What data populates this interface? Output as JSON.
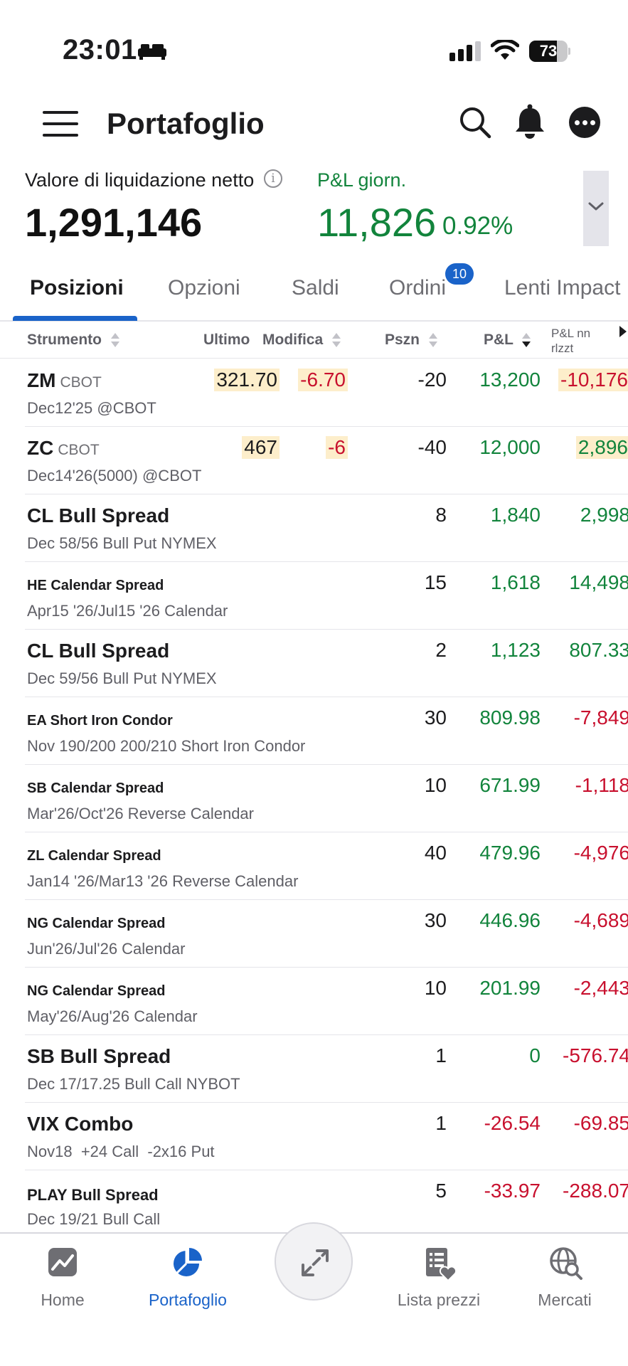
{
  "status_bar": {
    "time": "23:01",
    "battery": "73",
    "battery_level": 0.73,
    "icons": [
      "sleep-icon",
      "signal-icon",
      "wifi-icon",
      "battery-icon"
    ]
  },
  "header": {
    "title": "Portafoglio",
    "icons": [
      "menu-icon",
      "search-icon",
      "bell-icon",
      "more-icon"
    ]
  },
  "summary": {
    "nlv_label": "Valore di liquidazione netto",
    "nlv_value": "1,291,146",
    "daily_pnl_label": "P&L giorn.",
    "daily_pnl_value": "11,826",
    "daily_pnl_pct": "0.92%"
  },
  "tabs": [
    {
      "label": "Posizioni",
      "active": true
    },
    {
      "label": "Opzioni"
    },
    {
      "label": "Saldi"
    },
    {
      "label": "Ordini",
      "badge": "10"
    },
    {
      "label": "Lenti Impact"
    }
  ],
  "columns": {
    "instrument": "Strumento",
    "last": "Ultimo",
    "change": "Modifica",
    "position": "Pszn",
    "pnl": "P&L",
    "unrealized_line1": "P&L nn",
    "unrealized_line2": "rlzzt"
  },
  "positions": [
    {
      "symbol": "ZM",
      "exchange": "CBOT",
      "detail": "Dec12'25 @CBOT",
      "last": "321.70",
      "change": "-6.70",
      "position": "-20",
      "pnl": "13,200",
      "unrealized": "-10,176"
    },
    {
      "symbol": "ZC",
      "exchange": "CBOT",
      "detail": "Dec14'26(5000) @CBOT",
      "last": "467",
      "change": "-6",
      "position": "-40",
      "pnl": "12,000",
      "unrealized": "2,896"
    },
    {
      "symbol": "CL Bull Spread",
      "detail": "Dec 58/56 Bull Put NYMEX",
      "position": "8",
      "pnl": "1,840",
      "unrealized": "2,998"
    },
    {
      "symbol": "HE Calendar Spread",
      "detail": "Apr15 '26/Jul15 '26 Calendar",
      "position": "15",
      "pnl": "1,618",
      "unrealized": "14,498"
    },
    {
      "symbol": "CL Bull Spread",
      "detail": "Dec 59/56 Bull Put NYMEX",
      "position": "2",
      "pnl": "1,123",
      "unrealized": "807.33"
    },
    {
      "symbol": "EA Short Iron Condor",
      "detail": "Nov 190/200 200/210 Short Iron Condor",
      "position": "30",
      "pnl": "809.98",
      "unrealized": "-7,849"
    },
    {
      "symbol": "SB Calendar Spread",
      "detail": "Mar'26/Oct'26 Reverse Calendar",
      "position": "10",
      "pnl": "671.99",
      "unrealized": "-1,118"
    },
    {
      "symbol": "ZL Calendar Spread",
      "detail": "Jan14 '26/Mar13 '26 Reverse Calendar",
      "position": "40",
      "pnl": "479.96",
      "unrealized": "-4,976"
    },
    {
      "symbol": "NG Calendar Spread",
      "detail": "Jun'26/Jul'26 Calendar",
      "position": "30",
      "pnl": "446.96",
      "unrealized": "-4,689"
    },
    {
      "symbol": "NG Calendar Spread",
      "detail": "May'26/Aug'26 Calendar",
      "position": "10",
      "pnl": "201.99",
      "unrealized": "-2,443"
    },
    {
      "symbol": "SB Bull Spread",
      "detail": "Dec 17/17.25 Bull Call NYBOT",
      "position": "1",
      "pnl": "0",
      "unrealized": "-576.74"
    },
    {
      "symbol": "VIX Combo",
      "detail": "Nov18  +24 Call  -2x16 Put",
      "position": "1",
      "pnl": "-26.54",
      "unrealized": "-69.85"
    },
    {
      "symbol": "PLAY Bull Spread",
      "detail": "Dec 19/21 Bull Call",
      "position": "5",
      "pnl": "-33.97",
      "unrealized": "-288.07"
    }
  ],
  "bottom_nav": [
    {
      "label": "Home",
      "icon": "chart-line-icon"
    },
    {
      "label": "Portafoglio",
      "icon": "pie-chart-icon",
      "active": true
    },
    {
      "label": "",
      "icon": "expand-arrows-icon"
    },
    {
      "label": "Lista prezzi",
      "icon": "watchlist-heart-icon"
    },
    {
      "label": "Mercati",
      "icon": "globe-search-icon"
    }
  ],
  "colors": {
    "accent": "#1a63c9",
    "positive": "#12843c",
    "negative": "#c8102e",
    "highlight": "#fdeecb"
  }
}
